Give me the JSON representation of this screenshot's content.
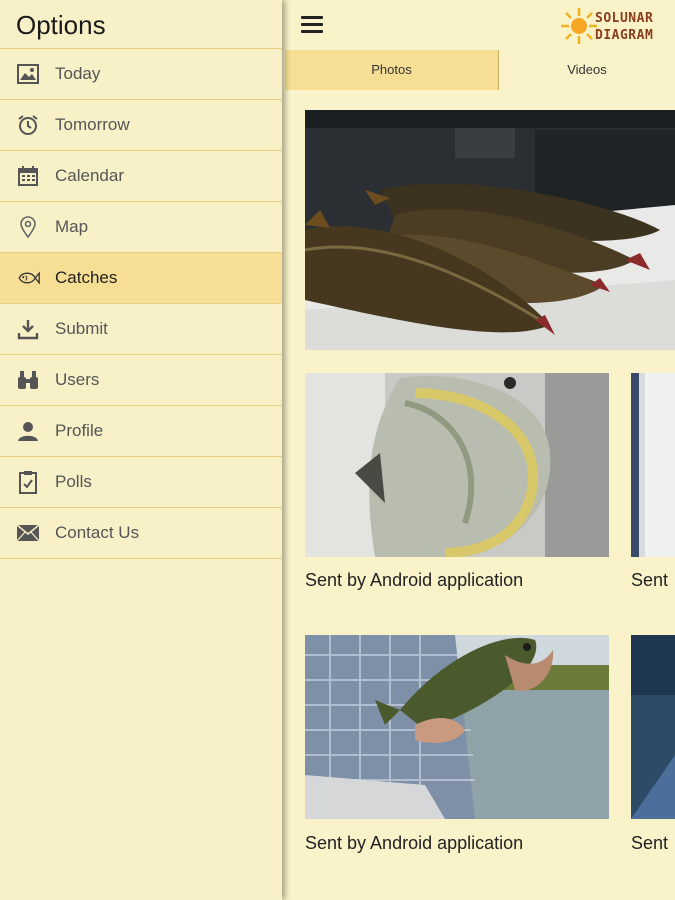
{
  "drawer": {
    "title": "Options",
    "items": [
      {
        "label": "Today",
        "icon": "image-icon"
      },
      {
        "label": "Tomorrow",
        "icon": "alarm-clock-icon"
      },
      {
        "label": "Calendar",
        "icon": "calendar-icon"
      },
      {
        "label": "Map",
        "icon": "map-pin-icon"
      },
      {
        "label": "Catches",
        "icon": "fish-icon",
        "active": true
      },
      {
        "label": "Submit",
        "icon": "download-icon"
      },
      {
        "label": "Users",
        "icon": "binoculars-icon"
      },
      {
        "label": "Profile",
        "icon": "person-icon"
      },
      {
        "label": "Polls",
        "icon": "clipboard-icon"
      },
      {
        "label": "Contact Us",
        "icon": "envelope-icon"
      }
    ]
  },
  "header": {
    "logo_line1": "SOLUNAR",
    "logo_line2": "DIAGRAM"
  },
  "tabs": [
    {
      "label": "Photos",
      "active": true
    },
    {
      "label": "Videos",
      "active": false
    }
  ],
  "gallery": {
    "captions": [
      "Sent by Android application",
      "Sent",
      "Sent by Android application",
      "Sent"
    ]
  },
  "colors": {
    "background": "#faf3c9",
    "active": "#f6df94",
    "divider": "#e8cf82",
    "logo_text": "#8a3c1c"
  }
}
